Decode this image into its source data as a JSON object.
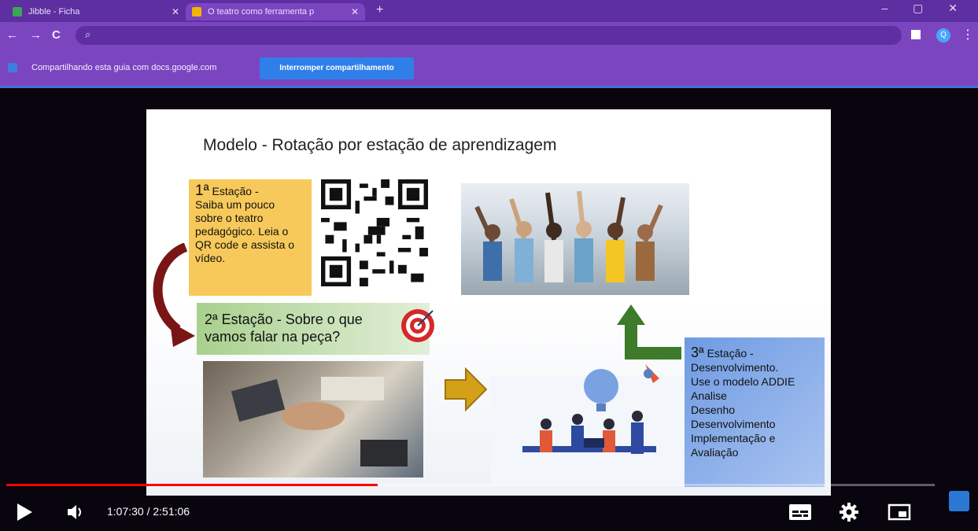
{
  "browser": {
    "tabs": [
      {
        "label": "Jibble - Ficha",
        "active": false
      },
      {
        "label": "O teatro como ferramenta p",
        "active": false
      }
    ],
    "newtab": "+",
    "window_controls": "– ▢ ✕",
    "nav": {
      "back": "←",
      "forward": "→",
      "reload": "C"
    },
    "omnibox_icon": "search-icon",
    "profile_initial": "Q",
    "menu": "⋮"
  },
  "sharebar": {
    "text": "Compartilhando esta guia com docs.google.com",
    "button": "Interromper compartilhamento"
  },
  "slide": {
    "title": "Modelo - Rotação por estação de aprendizagem",
    "station1": {
      "heading_num": "1ª",
      "heading": "Estação -",
      "body": "Saiba um pouco sobre o teatro pedagógico. Leia o QR code e assista o vídeo."
    },
    "station2": {
      "text": "2ª Estação - Sobre o que vamos falar na peça?"
    },
    "station3": {
      "heading_num": "3ª",
      "heading": "Estação -",
      "lines": [
        "Desenvolvimento.",
        "Use o modelo ADDIE",
        "Analise",
        "Desenho",
        "Desenvolvimento",
        "Implementação e",
        "Avaliação"
      ]
    }
  },
  "player": {
    "time": "1:07:30 / 2:51:06",
    "progress_fraction": 0.4,
    "accent": "#ff0000"
  }
}
